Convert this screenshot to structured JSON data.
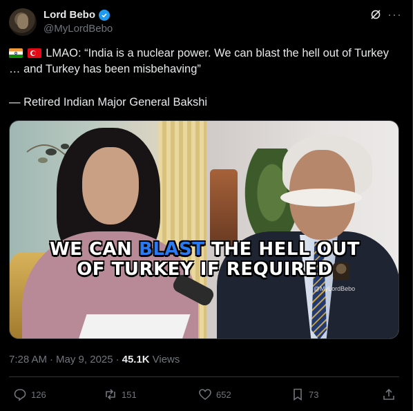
{
  "author": {
    "display_name": "Lord Bebo",
    "handle": "@MyLordBebo"
  },
  "tweet": {
    "text_main": "LMAO: “India is a nuclear power. We can blast the hell out of Turkey … and Turkey has been misbehaving”",
    "text_attribution": "— Retired Indian Major General Bakshi"
  },
  "media": {
    "caption_part1": "WE CAN ",
    "caption_highlight": "BLAST",
    "caption_part2": " THE HELL OUT",
    "caption_line2": "OF TURKEY IF REQUIRED",
    "watermark": "@MyLordBebo",
    "highlight_color": "#2a7bf2"
  },
  "meta": {
    "time": "7:28 AM",
    "separator": "·",
    "date": "May 9, 2025",
    "separator2": "·",
    "views_count": "45.1K",
    "views_label": "Views"
  },
  "actions": {
    "replies": "126",
    "reposts": "151",
    "likes": "652",
    "bookmarks": "73"
  },
  "colors": {
    "background": "#000000",
    "text": "#e7e9ea",
    "muted": "#71767b",
    "verified": "#1d9bf0",
    "divider": "#2f3336"
  }
}
